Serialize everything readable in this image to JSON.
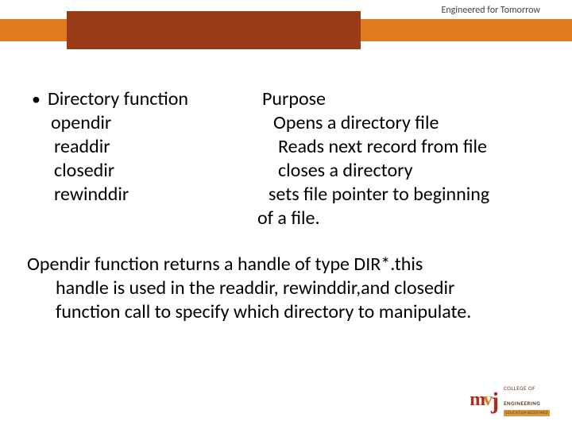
{
  "header": {
    "tagline": "Engineered for Tomorrow"
  },
  "bullet": {
    "left_heading": "Directory function",
    "right_heading": "Purpose",
    "items": [
      {
        "name": "opendir",
        "desc": "Opens a directory file"
      },
      {
        "name": "readdir",
        "desc": "Reads next record from file"
      },
      {
        "name": "closedir",
        "desc": "closes a directory"
      },
      {
        "name": "rewinddir",
        "desc": "sets file pointer to beginning"
      }
    ],
    "trailing_right": "of a file."
  },
  "paragraph": {
    "line1": "Opendir function returns a handle of type DIR*.this",
    "line2": "handle is used in the readdir, rewinddir,and closedir",
    "line3": "function call to specify which directory to manipulate."
  },
  "logo": {
    "text1": "COLLEGE OF",
    "text2": "ENGINEERING",
    "sub": "EDUCATION REDEFINED"
  }
}
